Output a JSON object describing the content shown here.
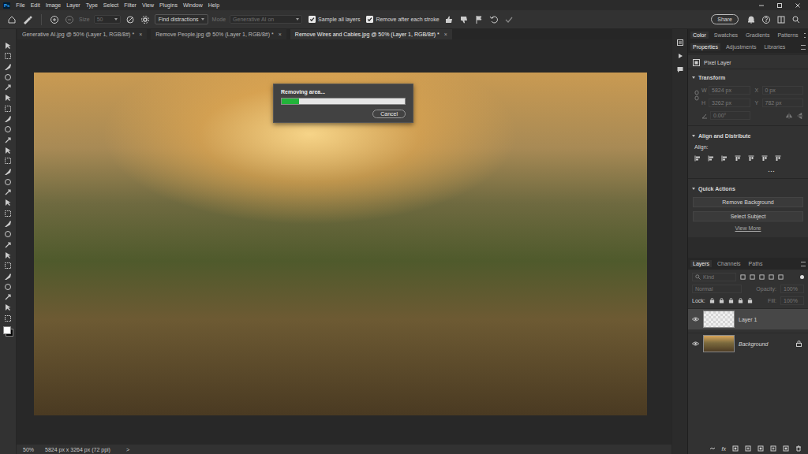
{
  "app": {
    "logo": "Ps"
  },
  "menu": [
    "File",
    "Edit",
    "Image",
    "Layer",
    "Type",
    "Select",
    "Filter",
    "View",
    "Plugins",
    "Window",
    "Help"
  ],
  "options_bar": {
    "size": {
      "label": "Size",
      "value": "50",
      "disabled": true
    },
    "find_button": "Find distractions",
    "mode": {
      "label": "Mode",
      "value": "Generative AI on",
      "disabled": true
    },
    "checkboxes": [
      {
        "label": "Sample all layers",
        "checked": true
      },
      {
        "label": "Remove after each stroke",
        "checked": true
      }
    ],
    "share_button": "Share"
  },
  "tabs": [
    {
      "label": "Generative AI.jpg @ 50% (Layer 1, RGB/8#) *",
      "selected": false,
      "close": "×"
    },
    {
      "label": "Remove People.jpg @ 50% (Layer 1, RGB/8#) *",
      "selected": false,
      "close": "×"
    },
    {
      "label": "Remove Wires and Cables.jpg @ 50% (Layer 1, RGB/8#) *",
      "selected": true,
      "close": "×"
    }
  ],
  "dialog": {
    "title": "Removing area...",
    "level": 0.14,
    "cancel": "Cancel"
  },
  "panel_tabs": [
    {
      "label": "Color",
      "selected": true
    },
    {
      "label": "Swatches",
      "selected": false
    },
    {
      "label": "Gradients",
      "selected": false
    },
    {
      "label": "Patterns",
      "selected": false
    }
  ],
  "properties_tabs": [
    {
      "label": "Properties",
      "selected": true
    },
    {
      "label": "Adjustments",
      "selected": false
    },
    {
      "label": "Libraries",
      "selected": false
    }
  ],
  "properties": {
    "layer_type": "Pixel Layer",
    "transform": {
      "title": "Transform",
      "expanded": true,
      "fields": [
        {
          "label": "W",
          "value": "5824 px"
        },
        {
          "label": "X",
          "value": "0 px"
        },
        {
          "label": "H",
          "value": "3262 px"
        },
        {
          "label": "Y",
          "value": "782 px"
        }
      ],
      "angle": "0.00°"
    },
    "align": {
      "title": "Align and Distribute",
      "expanded": true,
      "label": "Align:",
      "more": "..."
    },
    "quick_actions": {
      "title": "Quick Actions",
      "expanded": true,
      "buttons": [
        "Remove Background",
        "Select Subject"
      ],
      "link": "View More"
    }
  },
  "layers_panel": {
    "tabs": [
      {
        "label": "Layers",
        "selected": true
      },
      {
        "label": "Channels",
        "selected": false
      },
      {
        "label": "Paths",
        "selected": false
      }
    ],
    "kind": "Kind",
    "blend_mode": "Normal",
    "opacity_label": "Opacity:",
    "opacity": "100%",
    "lock_label": "Lock:",
    "fill_label": "Fill:",
    "fill": "100%",
    "layers": [
      {
        "name": "Layer 1",
        "selected": true,
        "visible": true,
        "locked": false,
        "kind": "transparent"
      },
      {
        "name": "Background",
        "selected": false,
        "visible": true,
        "locked": true,
        "kind": "photo"
      }
    ],
    "fx_label": "fx"
  },
  "status_bar": {
    "zoom": "50%",
    "dimensions": "5824 px x 3264 px (72 ppi)",
    "arrow": ">"
  }
}
